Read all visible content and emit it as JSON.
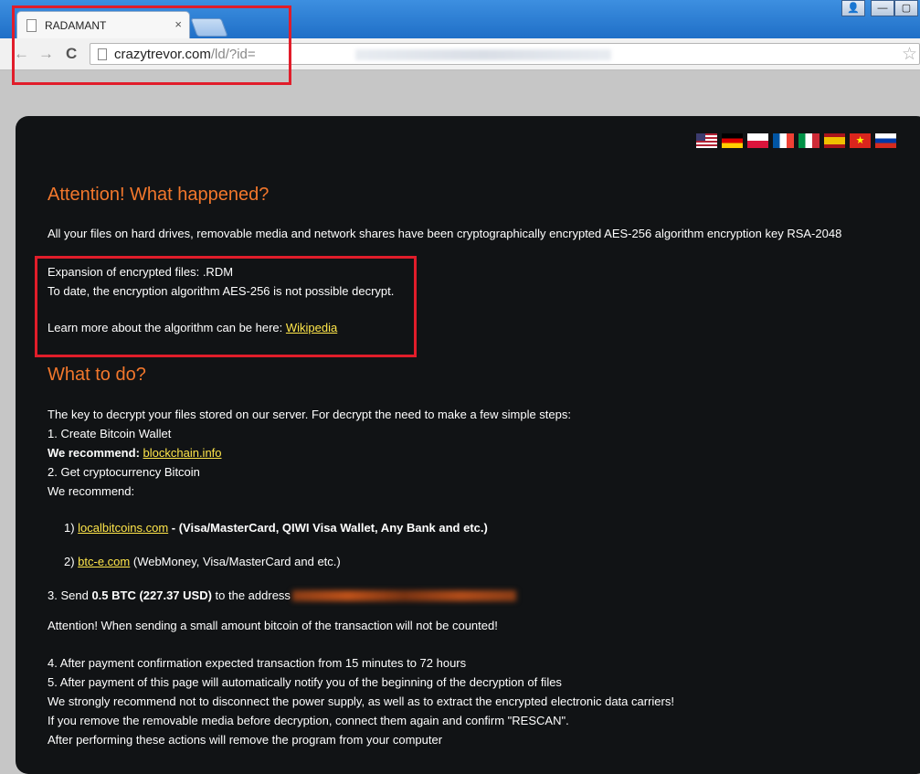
{
  "browser": {
    "tab_title": "RADAMANT",
    "tab_close": "×",
    "url_host": "crazytrevor.com",
    "url_path": "/ld/?id=",
    "back": "←",
    "forward": "→",
    "reload": "C",
    "star": "☆",
    "win_user": "👤",
    "win_min": "—",
    "win_max": "▢"
  },
  "flags": [
    "us-flag",
    "de-flag",
    "pl-flag",
    "fr-flag",
    "it-flag",
    "es-flag",
    "vn-flag",
    "ru-flag"
  ],
  "colors": {
    "accent": "#f2772c",
    "link": "#ffe64a",
    "panel": "#111315",
    "highlight_box": "#e11d2a"
  },
  "page": {
    "heading1": "Attention! What happened?",
    "intro": "All your files on hard drives, removable media and network shares have been cryptographically encrypted AES-256 algorithm encryption key RSA-2048",
    "expansion": "Expansion of encrypted files: .RDM",
    "to_date": "To date, the encryption algorithm AES-256 is not possible decrypt.",
    "learn_more": "Learn more about the algorithm can be here: ",
    "learn_more_link": "Wikipedia",
    "heading2": "What to do?",
    "key_text": "The key to decrypt your files stored on our server. For decrypt the need to make a few simple steps:",
    "step1": "1. Create Bitcoin Wallet",
    "we_recommend_bold": "We recommend: ",
    "blockchain_link": "blockchain.info",
    "step2": "2. Get cryptocurrency Bitcoin",
    "we_recommend": "We recommend:",
    "opt1_num": "1) ",
    "opt1_link": "localbitcoins.com",
    "opt1_rest": " - (Visa/MasterCard, QIWI Visa Wallet, Any Bank and etc.)",
    "opt2_num": "2) ",
    "opt2_link": "btc-e.com",
    "opt2_rest": " (WebMoney, Visa/MasterCard and etc.)",
    "step3_a": "3. Send ",
    "step3_b": "0.5 BTC (227.37 USD)",
    "step3_c": " to the address",
    "attention_small": "Attention! When sending a small amount bitcoin of the transaction will not be counted!",
    "step4": "4. After payment confirmation expected transaction from 15 minutes to 72 hours",
    "step5": "5. After payment of this page will automatically notify you of the beginning of the decryption of files",
    "power_note": "We strongly recommend not to disconnect the power supply, as well as to extract the encrypted electronic data carriers!",
    "removable_note": "If you remove the removable media before decryption, connect them again and confirm \"RESCAN\".",
    "after_note": "After performing these actions will remove the program from your computer"
  }
}
